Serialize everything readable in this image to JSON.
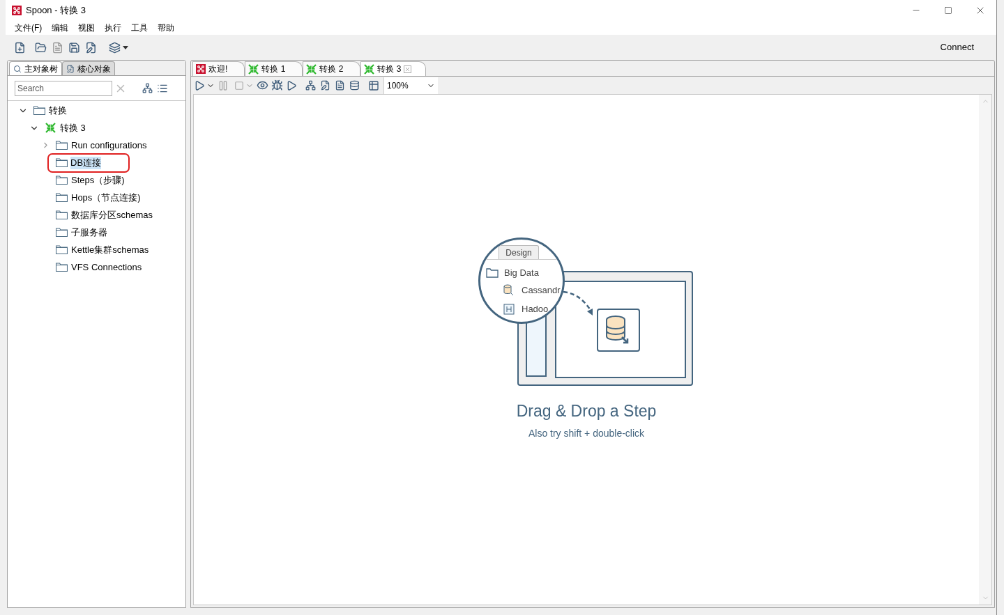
{
  "window": {
    "title": "Spoon - 转换 3"
  },
  "menu": [
    "文件(F)",
    "编辑",
    "视图",
    "执行",
    "工具",
    "帮助"
  ],
  "toolbar": {
    "connect": "Connect"
  },
  "left_tabs": [
    {
      "label": "主对象树",
      "selected": true
    },
    {
      "label": "核心对象",
      "selected": false
    }
  ],
  "search": {
    "placeholder": "Search"
  },
  "tree": [
    {
      "label": "转换",
      "kind": "folder",
      "expanded": true,
      "selected": false,
      "outlined": false,
      "children": [
        {
          "label": "转换 3",
          "kind": "transformation",
          "expanded": true,
          "selected": false,
          "outlined": false,
          "children": [
            {
              "label": "Run configurations",
              "kind": "folder",
              "expanded": false,
              "selected": false,
              "outlined": false
            },
            {
              "label": "DB连接",
              "kind": "folder",
              "selected": true,
              "outlined": true
            },
            {
              "label": "Steps（步骤)",
              "kind": "folder",
              "selected": false,
              "outlined": false
            },
            {
              "label": "Hops（节点连接)",
              "kind": "folder",
              "selected": false,
              "outlined": false
            },
            {
              "label": "数据库分区schemas",
              "kind": "folder",
              "selected": false,
              "outlined": false
            },
            {
              "label": "子服务器",
              "kind": "folder",
              "selected": false,
              "outlined": false
            },
            {
              "label": "Kettle集群schemas",
              "kind": "folder",
              "selected": false,
              "outlined": false
            },
            {
              "label": "VFS Connections",
              "kind": "folder",
              "selected": false,
              "outlined": false
            }
          ]
        }
      ]
    }
  ],
  "doc_tabs": [
    {
      "label": "欢迎!",
      "kind": "welcome",
      "selected": false
    },
    {
      "label": "转换 1",
      "kind": "transformation",
      "selected": false
    },
    {
      "label": "转换 2",
      "kind": "transformation",
      "selected": false
    },
    {
      "label": "转换 3",
      "kind": "transformation",
      "selected": true
    }
  ],
  "zoom": {
    "value": "100%"
  },
  "canvas": {
    "illustration": {
      "tab": "Design",
      "folder": "Big Data",
      "items": [
        "Cassandr",
        "Hadoo"
      ]
    },
    "title": "Drag & Drop a Step",
    "hint": "Also try shift + double-click"
  }
}
